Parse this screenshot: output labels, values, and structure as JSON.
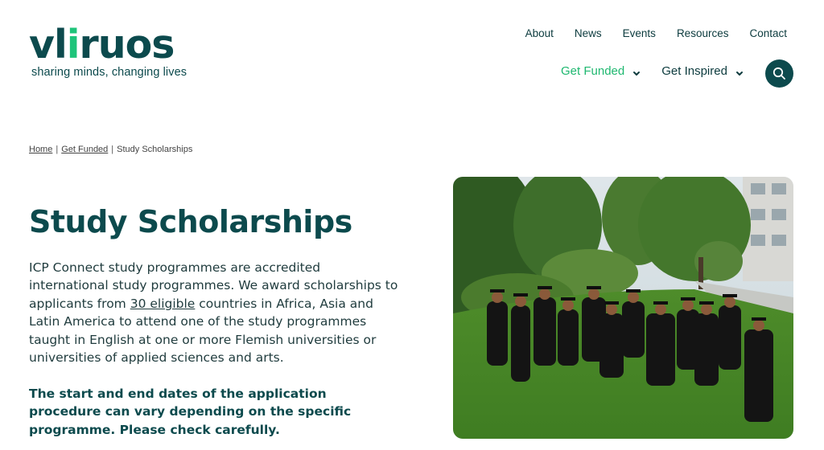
{
  "logo": {
    "part1": "vl",
    "accent": "i",
    "part2": "ruos",
    "tagline": "sharing minds, changing lives"
  },
  "top_nav": [
    "About",
    "News",
    "Events",
    "Resources",
    "Contact"
  ],
  "main_nav": {
    "funded": "Get Funded",
    "inspired": "Get Inspired"
  },
  "breadcrumb": {
    "home": "Home",
    "funded": "Get Funded",
    "current": "Study Scholarships",
    "separator": "|"
  },
  "page_title": "Study Scholarships",
  "intro": {
    "before": "ICP Connect study programmes are accredited international study programmes. We award scholarships to applicants from ",
    "link": "30 eligible",
    "after": " countries in Africa, Asia and Latin America to attend one of the study programmes taught in English at one or more Flemish universities or universities of applied sciences and arts."
  },
  "note": "The start and end dates of the application procedure can vary depending on the specific programme. Please check carefully.",
  "colors": {
    "brand": "#0c4a4d",
    "accent": "#1fc47a"
  }
}
